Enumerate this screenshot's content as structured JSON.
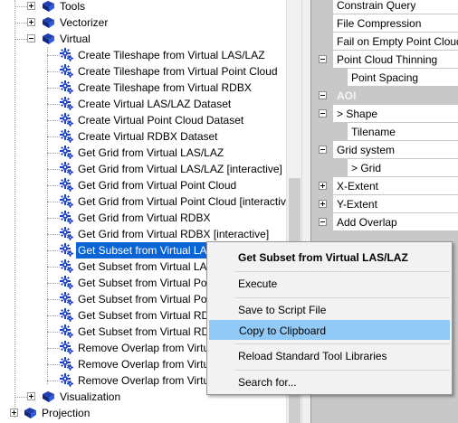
{
  "tree": {
    "top_items": [
      {
        "label": "Tools",
        "expanded": false
      },
      {
        "label": "Vectorizer",
        "expanded": false
      },
      {
        "label": "Virtual",
        "expanded": true
      }
    ],
    "virtual_children": [
      "Create Tileshape from Virtual LAS/LAZ",
      "Create Tileshape from Virtual Point Cloud",
      "Create Tileshape from Virtual RDBX",
      "Create Virtual LAS/LAZ Dataset",
      "Create Virtual Point Cloud Dataset",
      "Create Virtual RDBX Dataset",
      "Get Grid from Virtual LAS/LAZ",
      "Get Grid from Virtual LAS/LAZ [interactive]",
      "Get Grid from Virtual Point Cloud",
      "Get Grid from Virtual Point Cloud [interactiv",
      "Get Grid from Virtual RDBX",
      "Get Grid from Virtual RDBX [interactive]",
      "Get Subset from Virtual LAS/LAZ",
      "Get Subset from Virtual LAS",
      "Get Subset from Virtual Poi",
      "Get Subset from Virtual Poi",
      "Get Subset from Virtual RD",
      "Get Subset from Virtual RD",
      "Remove Overlap from Virtu",
      "Remove Overlap from Virtu",
      "Remove Overlap from Virtu"
    ],
    "bottom_items": [
      {
        "label": "Visualization",
        "expanded": false
      },
      {
        "label": "Projection",
        "expanded": false
      }
    ],
    "selected_index": 12
  },
  "props": {
    "rows": [
      {
        "label": "Constrain Query",
        "type": "item"
      },
      {
        "label": "File Compression",
        "type": "item"
      },
      {
        "label": "Fail on Empty Point Cloud",
        "type": "item"
      },
      {
        "label": "Point Cloud Thinning",
        "type": "group"
      },
      {
        "label": "Point Spacing",
        "type": "child"
      },
      {
        "label": "AOI",
        "type": "category"
      },
      {
        "label": "> Shape",
        "type": "group"
      },
      {
        "label": "Tilename",
        "type": "child"
      },
      {
        "label": "Grid system",
        "type": "group"
      },
      {
        "label": "> Grid",
        "type": "child"
      },
      {
        "label": "X-Extent",
        "type": "groupplus"
      },
      {
        "label": "Y-Extent",
        "type": "groupplus"
      },
      {
        "label": "Add Overlap",
        "type": "group"
      }
    ]
  },
  "context_menu": {
    "title": "Get Subset from Virtual LAS/LAZ",
    "items": [
      "Execute",
      "Save to Script File",
      "Copy to Clipboard",
      "Reload Standard Tool Libraries",
      "Search for..."
    ],
    "highlighted": "Copy to Clipboard"
  },
  "colors": {
    "selection": "#0a64d6",
    "menu_highlight": "#91c9f7",
    "book": "#1f3fb0",
    "gear": "#1b3fc4"
  }
}
